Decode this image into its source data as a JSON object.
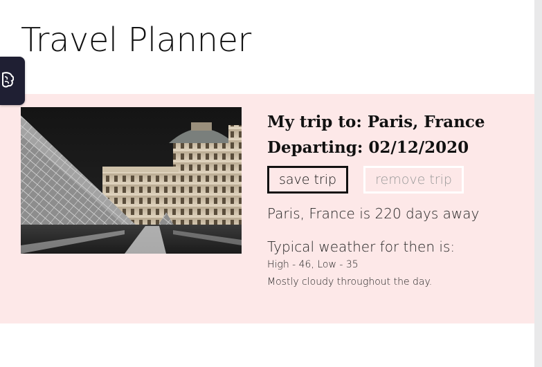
{
  "app": {
    "title": "Travel Planner"
  },
  "trip": {
    "heading": "My trip to: Paris, France",
    "departing": "Departing: 02/12/2020",
    "photo_subject": "Louvre pyramid at night",
    "save_label": "save trip",
    "remove_label": "remove trip",
    "countdown": "Paris, France is 220 days away",
    "weather_label": "Typical weather for then is:",
    "weather_temps": "High - 46, Low - 35",
    "weather_summary": "Mostly cloudy throughout the day."
  },
  "colors": {
    "card_background": "#fde8e8",
    "side_handle": "#1f1f33",
    "text": "#111111"
  },
  "icons": {
    "side_handle_icon": "brain-icon"
  }
}
